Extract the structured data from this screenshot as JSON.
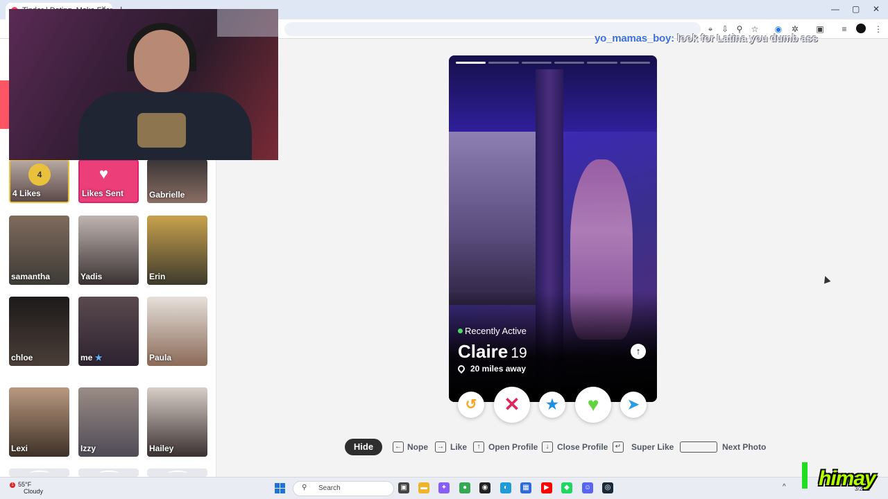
{
  "browser": {
    "tab_title": "Tinder | Dating, Make Friends &",
    "tab_close": "×",
    "new_tab": "+",
    "window_controls": [
      "—",
      "▢",
      "✕"
    ]
  },
  "sidebar": {
    "likes_card": {
      "count": "4",
      "label": "4 Likes"
    },
    "likes_sent_card": {
      "label": "Likes Sent"
    },
    "matches": [
      {
        "name": "Gabrielle",
        "colors": [
          "#3a3536",
          "#8a6e64"
        ]
      },
      {
        "name": "samantha",
        "colors": [
          "#7f6b5c",
          "#3d3a36"
        ]
      },
      {
        "name": "Yadis",
        "colors": [
          "#bfb4b0",
          "#3a3232"
        ]
      },
      {
        "name": "Erin",
        "colors": [
          "#c9a24d",
          "#3d3a2c"
        ]
      },
      {
        "name": "chloe",
        "colors": [
          "#1c1a1a",
          "#4b3e38"
        ]
      },
      {
        "name": "me",
        "colors": [
          "#5a4a4e",
          "#2d2230"
        ],
        "badge": "★"
      },
      {
        "name": "Paula",
        "colors": [
          "#e6e0da",
          "#8b6a58"
        ]
      },
      {
        "name": "Lexi",
        "colors": [
          "#b99a80",
          "#3e3028"
        ]
      },
      {
        "name": "Izzy",
        "colors": [
          "#9a8c86",
          "#4e4a55"
        ]
      },
      {
        "name": "Hailey",
        "colors": [
          "#d8cfc8",
          "#3a3030"
        ]
      }
    ]
  },
  "profile": {
    "status": "Recently Active",
    "name": "Claire",
    "age": "19",
    "distance": "20 miles away",
    "photo_count": 6,
    "active_photo": 1
  },
  "actions": [
    {
      "name": "rewind",
      "symbol": "↺",
      "color": "#f5a623"
    },
    {
      "name": "nope",
      "symbol": "✕",
      "color": "#e0245e"
    },
    {
      "name": "super-like",
      "symbol": "★",
      "color": "#1e8fe1"
    },
    {
      "name": "like",
      "symbol": "♥",
      "color": "#5fd43f"
    },
    {
      "name": "boost",
      "symbol": "➤",
      "color": "#2b9be6"
    }
  ],
  "shortcuts": {
    "hide": "Hide",
    "items": [
      {
        "key": "←",
        "label": "Nope"
      },
      {
        "key": "→",
        "label": "Like"
      },
      {
        "key": "↑",
        "label": "Open Profile"
      },
      {
        "key": "↓",
        "label": "Close Profile"
      },
      {
        "key": "↵",
        "label": "Super Like"
      },
      {
        "key": "",
        "label": "Next Photo"
      }
    ]
  },
  "chat": {
    "user": "yo_mamas_boy:",
    "message": "look for Latina you dumb ass"
  },
  "taskbar": {
    "temperature": "55°F",
    "condition": "Cloudy",
    "notification": "1",
    "search_placeholder": "Search",
    "date": "3/26/2"
  },
  "overlay": {
    "brand": "himay"
  },
  "colors": {
    "accent": "#fd5564",
    "gold": "#e9c13b",
    "online": "#4cd964"
  }
}
